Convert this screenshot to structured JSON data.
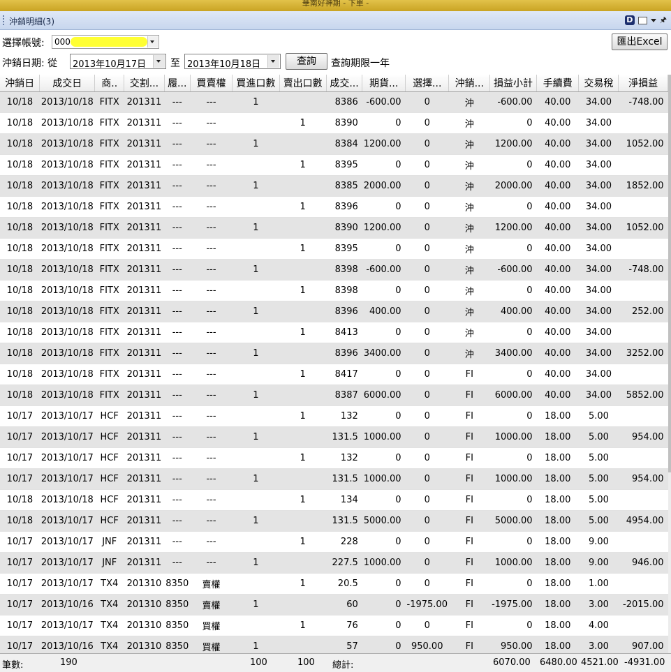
{
  "window": {
    "title": "華南好神期 - 下單 -"
  },
  "panel": {
    "title": "沖銷明細(3)"
  },
  "account": {
    "label": "選擇帳號:",
    "value": "000-"
  },
  "export_button": "匯出Excel",
  "date_filter": {
    "label": "沖銷日期: 從",
    "from": "2013年10月17日",
    "to_label": "至",
    "to": "2013年10月18日",
    "query_button": "查詢",
    "note": "查詢期限一年"
  },
  "table": {
    "columns": [
      "沖銷日",
      "成交日",
      "商..",
      "交割...",
      "履...",
      "買賣權",
      "買進口數",
      "賣出口數",
      "成交...",
      "期貨...",
      "選擇...",
      "沖銷...",
      "損益小計",
      "手續費",
      "交易稅",
      "淨損益"
    ],
    "rows": [
      [
        "10/18",
        "2013/10/18",
        "FITX",
        "201311",
        "---",
        "---",
        "1",
        "",
        "8386",
        "-600.00",
        "0",
        "沖",
        "-600.00",
        "40.00",
        "34.00",
        "-748.00"
      ],
      [
        "10/18",
        "2013/10/18",
        "FITX",
        "201311",
        "---",
        "---",
        "",
        "1",
        "8390",
        "0",
        "0",
        "沖",
        "0",
        "40.00",
        "34.00",
        ""
      ],
      [
        "10/18",
        "2013/10/18",
        "FITX",
        "201311",
        "---",
        "---",
        "1",
        "",
        "8384",
        "1200.00",
        "0",
        "沖",
        "1200.00",
        "40.00",
        "34.00",
        "1052.00"
      ],
      [
        "10/18",
        "2013/10/18",
        "FITX",
        "201311",
        "---",
        "---",
        "",
        "1",
        "8395",
        "0",
        "0",
        "沖",
        "0",
        "40.00",
        "34.00",
        ""
      ],
      [
        "10/18",
        "2013/10/18",
        "FITX",
        "201311",
        "---",
        "---",
        "1",
        "",
        "8385",
        "2000.00",
        "0",
        "沖",
        "2000.00",
        "40.00",
        "34.00",
        "1852.00"
      ],
      [
        "10/18",
        "2013/10/18",
        "FITX",
        "201311",
        "---",
        "---",
        "",
        "1",
        "8396",
        "0",
        "0",
        "沖",
        "0",
        "40.00",
        "34.00",
        ""
      ],
      [
        "10/18",
        "2013/10/18",
        "FITX",
        "201311",
        "---",
        "---",
        "1",
        "",
        "8390",
        "1200.00",
        "0",
        "沖",
        "1200.00",
        "40.00",
        "34.00",
        "1052.00"
      ],
      [
        "10/18",
        "2013/10/18",
        "FITX",
        "201311",
        "---",
        "---",
        "",
        "1",
        "8395",
        "0",
        "0",
        "沖",
        "0",
        "40.00",
        "34.00",
        ""
      ],
      [
        "10/18",
        "2013/10/18",
        "FITX",
        "201311",
        "---",
        "---",
        "1",
        "",
        "8398",
        "-600.00",
        "0",
        "沖",
        "-600.00",
        "40.00",
        "34.00",
        "-748.00"
      ],
      [
        "10/18",
        "2013/10/18",
        "FITX",
        "201311",
        "---",
        "---",
        "",
        "1",
        "8398",
        "0",
        "0",
        "沖",
        "0",
        "40.00",
        "34.00",
        ""
      ],
      [
        "10/18",
        "2013/10/18",
        "FITX",
        "201311",
        "---",
        "---",
        "1",
        "",
        "8396",
        "400.00",
        "0",
        "沖",
        "400.00",
        "40.00",
        "34.00",
        "252.00"
      ],
      [
        "10/18",
        "2013/10/18",
        "FITX",
        "201311",
        "---",
        "---",
        "",
        "1",
        "8413",
        "0",
        "0",
        "沖",
        "0",
        "40.00",
        "34.00",
        ""
      ],
      [
        "10/18",
        "2013/10/18",
        "FITX",
        "201311",
        "---",
        "---",
        "1",
        "",
        "8396",
        "3400.00",
        "0",
        "沖",
        "3400.00",
        "40.00",
        "34.00",
        "3252.00"
      ],
      [
        "10/18",
        "2013/10/18",
        "FITX",
        "201311",
        "---",
        "---",
        "",
        "1",
        "8417",
        "0",
        "0",
        "FI",
        "0",
        "40.00",
        "34.00",
        ""
      ],
      [
        "10/18",
        "2013/10/18",
        "FITX",
        "201311",
        "---",
        "---",
        "1",
        "",
        "8387",
        "6000.00",
        "0",
        "FI",
        "6000.00",
        "40.00",
        "34.00",
        "5852.00"
      ],
      [
        "10/17",
        "2013/10/17",
        "HCF",
        "201311",
        "---",
        "---",
        "",
        "1",
        "132",
        "0",
        "0",
        "FI",
        "0",
        "18.00",
        "5.00",
        ""
      ],
      [
        "10/17",
        "2013/10/17",
        "HCF",
        "201311",
        "---",
        "---",
        "1",
        "",
        "131.5",
        "1000.00",
        "0",
        "FI",
        "1000.00",
        "18.00",
        "5.00",
        "954.00"
      ],
      [
        "10/17",
        "2013/10/17",
        "HCF",
        "201311",
        "---",
        "---",
        "",
        "1",
        "132",
        "0",
        "0",
        "FI",
        "0",
        "18.00",
        "5.00",
        ""
      ],
      [
        "10/17",
        "2013/10/17",
        "HCF",
        "201311",
        "---",
        "---",
        "1",
        "",
        "131.5",
        "1000.00",
        "0",
        "FI",
        "1000.00",
        "18.00",
        "5.00",
        "954.00"
      ],
      [
        "10/18",
        "2013/10/18",
        "HCF",
        "201311",
        "---",
        "---",
        "",
        "1",
        "134",
        "0",
        "0",
        "FI",
        "0",
        "18.00",
        "5.00",
        ""
      ],
      [
        "10/18",
        "2013/10/17",
        "HCF",
        "201311",
        "---",
        "---",
        "1",
        "",
        "131.5",
        "5000.00",
        "0",
        "FI",
        "5000.00",
        "18.00",
        "5.00",
        "4954.00"
      ],
      [
        "10/17",
        "2013/10/17",
        "JNF",
        "201311",
        "---",
        "---",
        "",
        "1",
        "228",
        "0",
        "0",
        "FI",
        "0",
        "18.00",
        "9.00",
        ""
      ],
      [
        "10/17",
        "2013/10/17",
        "JNF",
        "201311",
        "---",
        "---",
        "1",
        "",
        "227.5",
        "1000.00",
        "0",
        "FI",
        "1000.00",
        "18.00",
        "9.00",
        "946.00"
      ],
      [
        "10/17",
        "2013/10/17",
        "TX4",
        "201310",
        "8350",
        "賣權",
        "",
        "1",
        "20.5",
        "0",
        "0",
        "FI",
        "0",
        "18.00",
        "1.00",
        ""
      ],
      [
        "10/17",
        "2013/10/16",
        "TX4",
        "201310",
        "8350",
        "賣權",
        "1",
        "",
        "60",
        "0",
        "-1975.00",
        "FI",
        "-1975.00",
        "18.00",
        "3.00",
        "-2015.00"
      ],
      [
        "10/17",
        "2013/10/17",
        "TX4",
        "201310",
        "8350",
        "買權",
        "",
        "1",
        "76",
        "0",
        "0",
        "FI",
        "0",
        "18.00",
        "4.00",
        ""
      ],
      [
        "10/17",
        "2013/10/16",
        "TX4",
        "201310",
        "8350",
        "買權",
        "1",
        "",
        "57",
        "0",
        "950.00",
        "FI",
        "950.00",
        "18.00",
        "3.00",
        "907.00"
      ]
    ]
  },
  "footer": {
    "count_label": "筆數:",
    "count": "190",
    "buy_total": "100",
    "sell_total": "100",
    "total_label": "總計:",
    "pl_total": "6070.00",
    "fee_total": "6480.00",
    "tax_total": "4521.00",
    "net_total": "-4931.00"
  }
}
